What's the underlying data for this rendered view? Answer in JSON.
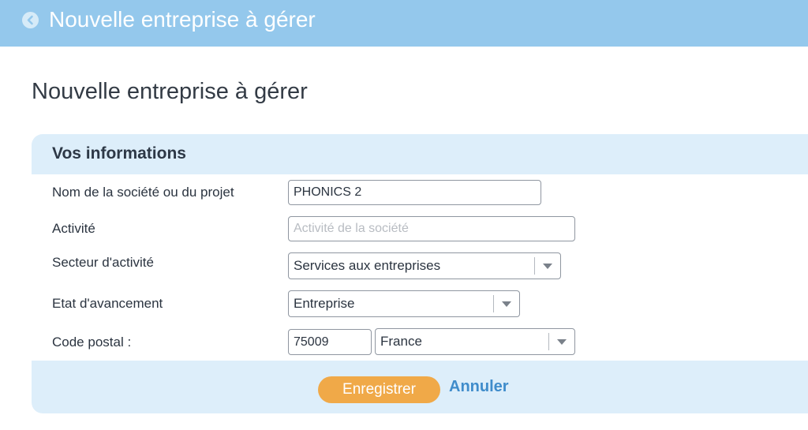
{
  "header": {
    "title": "Nouvelle entreprise à gérer",
    "back_icon": "chevron-left-circle-icon"
  },
  "page": {
    "title": "Nouvelle entreprise à gérer"
  },
  "form": {
    "section_title": "Vos informations",
    "company_name": {
      "label": "Nom de la société ou du projet",
      "value": "PHONICS 2"
    },
    "activity": {
      "label": "Activité",
      "value": "",
      "placeholder": "Activité de la société"
    },
    "sector": {
      "label": "Secteur d'activité",
      "value": "Services aux entreprises"
    },
    "stage": {
      "label": "Etat d'avancement",
      "value": "Entreprise"
    },
    "postal": {
      "label": "Code postal :",
      "value": "75009",
      "country": "France"
    }
  },
  "actions": {
    "save_label": "Enregistrer",
    "cancel_label": "Annuler"
  },
  "colors": {
    "topbar": "#94c8ec",
    "section_bg": "#ddeefa",
    "save_button": "#f0a948",
    "cancel_link": "#3f8ccb"
  }
}
